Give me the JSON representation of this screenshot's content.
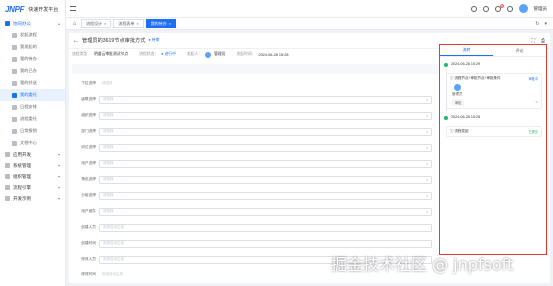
{
  "app": {
    "logo_mark": "JNPF",
    "logo_text": "快速开发平台"
  },
  "sidebar": {
    "groups": [
      {
        "label": "协同办公",
        "active": true
      },
      {
        "label": "应用开发"
      },
      {
        "label": "系统管理"
      },
      {
        "label": "组织管理"
      },
      {
        "label": "流程引擎"
      },
      {
        "label": "开发示例"
      }
    ],
    "items": [
      {
        "label": "发起流程"
      },
      {
        "label": "我发起的"
      },
      {
        "label": "我的待办"
      },
      {
        "label": "我的已办"
      },
      {
        "label": "我的抄送"
      },
      {
        "label": "我的委托"
      },
      {
        "label": "日程安排"
      },
      {
        "label": "流程委托"
      },
      {
        "label": "日常报销"
      },
      {
        "label": "文档中心"
      }
    ]
  },
  "topbar": {
    "user": "管理员",
    "badge": "3"
  },
  "tabs": [
    {
      "label": "流程设计"
    },
    {
      "label": "流程表单"
    },
    {
      "label": "我的待办",
      "active": true
    }
  ],
  "page": {
    "back": "←",
    "title": "管理员的3619节点审批方式",
    "status": "● 待审"
  },
  "info": {
    "type_label": "流程类型：",
    "type_value": "明道云审批测试节点",
    "state_label": "流程状态：",
    "state_value": "● 进行中",
    "initiator_label": "发起人：",
    "initiator_value": "管理员",
    "time_label": "发起时间：",
    "time_value": "2024-06-28 15:28"
  },
  "form": {
    "rows": [
      {
        "label": "下拉选择",
        "placeholder": "请选择",
        "chevron": true
      },
      {
        "label": "级联选择",
        "placeholder": "请选择",
        "chevron": true
      },
      {
        "label": "组织选择",
        "placeholder": "请选择",
        "chevron": true
      },
      {
        "label": "部门选择",
        "placeholder": "请选择",
        "chevron": true
      },
      {
        "label": "岗位选择",
        "placeholder": "请选择",
        "chevron": true
      },
      {
        "label": "用户选择",
        "placeholder": "请选择",
        "chevron": true
      },
      {
        "label": "角色选择",
        "placeholder": "请选择",
        "chevron": true
      },
      {
        "label": "分组选择",
        "placeholder": "请选择",
        "chevron": true
      },
      {
        "label": "用户组件",
        "placeholder": "请选择",
        "chevron": true
      },
      {
        "label": "创建人员",
        "placeholder": "系统自动生成",
        "chevron": false
      },
      {
        "label": "创建时间",
        "placeholder": "系统自动生成",
        "chevron": false
      },
      {
        "label": "修改人员",
        "placeholder": "系统自动生成",
        "chevron": false
      },
      {
        "label": "修改时间",
        "placeholder": "系统自动生成",
        "chevron": false
      }
    ]
  },
  "panel": {
    "tabs": [
      "流转",
      "评论"
    ],
    "items": [
      {
        "time": "2024-06-28 15:29",
        "title": "ⓘ 流程节点+审批节点+审批条件",
        "tag": "审批中",
        "user": "管理员",
        "chip": "审批"
      },
      {
        "time": "2024-06-28 15:28",
        "title": "ⓘ 流程发起",
        "tag": "已提交"
      }
    ]
  },
  "watermark": "掘金技术社区 @ jnpfsoft"
}
